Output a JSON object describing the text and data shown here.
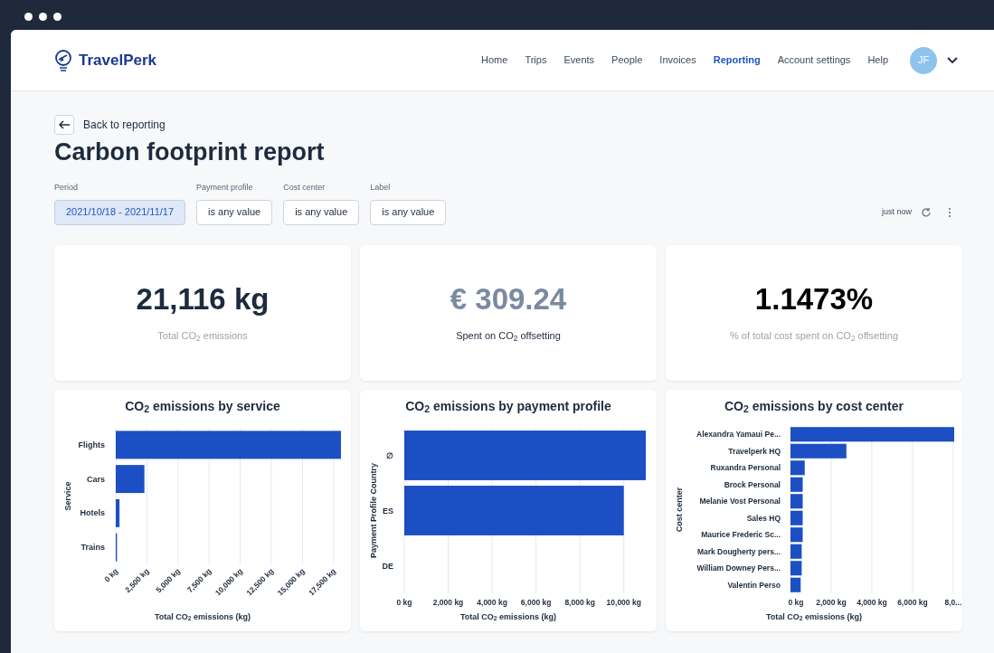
{
  "brand": {
    "name": "TravelPerk"
  },
  "nav": {
    "items": [
      {
        "label": "Home",
        "selected": false
      },
      {
        "label": "Trips",
        "selected": false
      },
      {
        "label": "Events",
        "selected": false
      },
      {
        "label": "People",
        "selected": false
      },
      {
        "label": "Invoices",
        "selected": false
      },
      {
        "label": "Reporting",
        "selected": true
      },
      {
        "label": "Account settings",
        "selected": false
      },
      {
        "label": "Help",
        "selected": false
      }
    ],
    "avatar": "JF"
  },
  "back_link": "Back to reporting",
  "title": "Carbon footprint report",
  "filters": [
    {
      "label": "Period",
      "value": "2021/10/18 - 2021/11/17",
      "selected": true
    },
    {
      "label": "Payment profile",
      "value": "is any value",
      "selected": false
    },
    {
      "label": "Cost center",
      "value": "is any value",
      "selected": false
    },
    {
      "label": "Label",
      "value": "is any value",
      "selected": false
    }
  ],
  "updated": "just now",
  "kpis": [
    {
      "kind": "primary",
      "value": "21,116 kg",
      "label": "Total CO$_{2}$ emissions"
    },
    {
      "kind": "muted",
      "value": "€ 309.24",
      "label": "Spent on CO$_{2}$ offsetting"
    },
    {
      "kind": "strong",
      "value": "1.1473%",
      "label": "% of total cost spent on CO$_{2}$ offsetting"
    }
  ],
  "charts": [
    {
      "chart_data": {
        "type": "bar",
        "orientation": "horizontal",
        "title": "CO$_{2}$ emissions by service",
        "xlabel": "Total CO$_{2}$ emissions (kg)",
        "ylabel": "Service",
        "categories": [
          "Flights",
          "Cars",
          "Hotels",
          "Trains"
        ],
        "series": [
          {
            "color": "#1c4fc4",
            "values": [
              18100,
              2300,
              300,
              100
            ]
          }
        ],
        "xlim": [
          0,
          18100
        ],
        "grid": true,
        "xticks": [
          {
            "value": 0,
            "label": "0 kg"
          },
          {
            "value": 2500,
            "label": "2,500 kg"
          },
          {
            "value": 5000,
            "label": "5,000 kg"
          },
          {
            "value": 7500,
            "label": "7,500 kg"
          },
          {
            "value": 10000,
            "label": "10,000 kg"
          },
          {
            "value": 12500,
            "label": "12,500 kg"
          },
          {
            "value": 15000,
            "label": "15,000 kg"
          },
          {
            "value": 17500,
            "label": "17,500 kg"
          }
        ]
      }
    },
    {
      "chart_data": {
        "type": "bar",
        "orientation": "horizontal",
        "title": "CO$_{2}$ emissions by payment profile",
        "xlabel": "Total CO$_{2}$ emissions (kg)",
        "ylabel": "Payment Profile Country",
        "categories": [
          "∅",
          "ES",
          "DE"
        ],
        "series": [
          {
            "color": "#1c4fc4",
            "values": [
              11000,
              10000,
              0
            ]
          }
        ],
        "xlim": [
          0,
          11000
        ],
        "grid": true,
        "xticks": [
          {
            "value": 0,
            "label": "0 kg"
          },
          {
            "value": 2000,
            "label": "2,000 kg"
          },
          {
            "value": 4000,
            "label": "4,000 kg"
          },
          {
            "value": 6000,
            "label": "6,000 kg"
          },
          {
            "value": 8000,
            "label": "8,000 kg"
          },
          {
            "value": 10000,
            "label": "10,000 kg"
          }
        ]
      }
    },
    {
      "chart_data": {
        "type": "bar",
        "orientation": "horizontal",
        "title": "CO$_{2}$ emissions by cost center",
        "xlabel": "Total CO$_{2}$ emissions (kg)",
        "ylabel": "Cost center",
        "categories": [
          "Alexandra Yamaui Pe...",
          "Travelperk HQ",
          "Ruxandra Personal",
          "Brock Personal",
          "Melanie Vost Personal",
          "Sales HQ",
          "Maurice Frederic Sc...",
          "Mark Dougherty pers...",
          "William Downey Pers...",
          "Valentin Perso"
        ],
        "series": [
          {
            "color": "#1c4fc4",
            "values": [
              8050,
              2750,
              700,
              600,
              600,
              600,
              600,
              550,
              550,
              500
            ]
          }
        ],
        "xlim": [
          0,
          8050
        ],
        "grid": true,
        "xticks": [
          {
            "value": 0,
            "label": "0 kg"
          },
          {
            "value": 2000,
            "label": "2,000 kg"
          },
          {
            "value": 4000,
            "label": "4,000 kg"
          },
          {
            "value": 6000,
            "label": "6,000 kg"
          },
          {
            "value": 8000,
            "label": "8,0..."
          }
        ]
      }
    }
  ]
}
